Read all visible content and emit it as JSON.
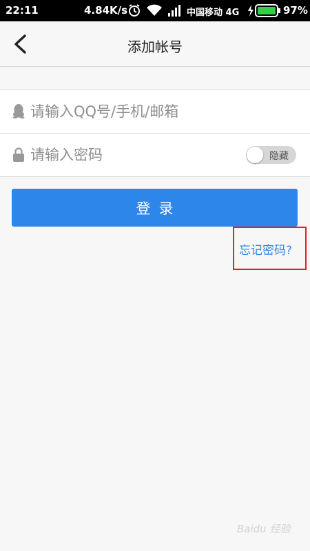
{
  "status_bar": {
    "time": "22:11",
    "net_speed": "4.84K/s",
    "carrier": "中国移动 4G",
    "battery_percent": "97%",
    "icons": [
      "alarm-icon",
      "wifi-icon",
      "signal-icon",
      "charging-icon",
      "battery-icon"
    ]
  },
  "header": {
    "title": "添加帐号",
    "back_icon": "chevron-left-icon"
  },
  "form": {
    "account": {
      "placeholder": "请输入QQ号/手机/邮箱",
      "value": "",
      "icon": "qq-penguin-icon"
    },
    "password": {
      "placeholder": "请输入密码",
      "value": "",
      "icon": "lock-icon"
    },
    "visibility_toggle": {
      "label": "隐藏",
      "on": false
    }
  },
  "login_button": {
    "label": "登录"
  },
  "forgot_link": {
    "label": "忘记密码?"
  },
  "watermark": {
    "text": "Baidu 经验"
  },
  "colors": {
    "accent": "#2d86e9",
    "highlight_box": "#e32028",
    "background": "#f7f7f7",
    "status_bar": "#000000"
  }
}
